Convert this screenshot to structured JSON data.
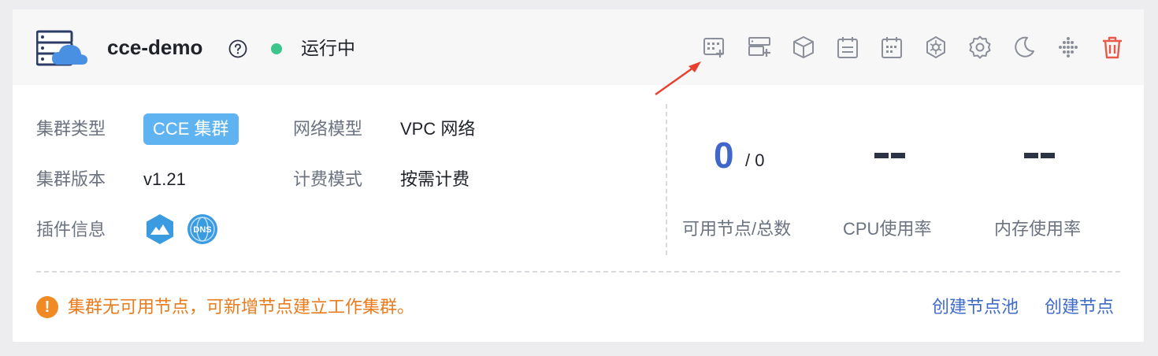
{
  "cluster": {
    "name": "cce-demo",
    "status": "运行中",
    "status_color": "#3ec58e"
  },
  "toolbar": {
    "icons": [
      "add-node-grid-icon",
      "add-nodepool-icon",
      "cube-icon",
      "calendar-icon",
      "calendar-list-icon",
      "network-icon",
      "settings-icon",
      "moon-icon",
      "dots-grid-icon",
      "trash-icon"
    ]
  },
  "info": {
    "cluster_type_label": "集群类型",
    "cluster_type_value": "CCE 集群",
    "network_model_label": "网络模型",
    "network_model_value": "VPC 网络",
    "version_label": "集群版本",
    "version_value": "v1.21",
    "billing_label": "计费模式",
    "billing_value": "按需计费",
    "plugins_label": "插件信息",
    "plugin_dns": "DNS"
  },
  "metrics": {
    "available_nodes": "0",
    "total_nodes": "/ 0",
    "nodes_label": "可用节点/总数",
    "cpu_label": "CPU使用率",
    "mem_label": "内存使用率"
  },
  "footer": {
    "warning_icon": "!",
    "warning": "集群无可用节点，可新增节点建立工作集群。",
    "warning_color": "#e97b1d",
    "create_pool": "创建节点池",
    "create_node": "创建节点"
  },
  "colors": {
    "accent": "#3e6ac9",
    "tag": "#5fb3f0",
    "danger": "#e8594a"
  }
}
